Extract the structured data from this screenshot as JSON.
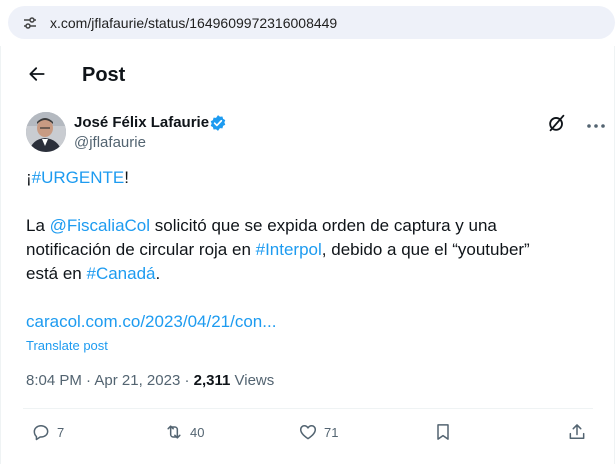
{
  "browser": {
    "url": "x.com/jflafaurie/status/1649609972316008449",
    "site_icon": "site-settings-icon"
  },
  "header": {
    "back_icon": "back-arrow-icon",
    "title": "Post"
  },
  "author": {
    "name": "José Félix Lafaurie",
    "handle": "@jflafaurie",
    "verified": true,
    "badge_color": "#1d9bf0"
  },
  "tweet": {
    "line1_prefix": "¡",
    "line1_hashtag": "#URGENTE",
    "line1_suffix": "!",
    "line2_prefix": "La ",
    "line2_mention": "@FiscaliaCol",
    "line2_suffix": " solicitó que se expida orden de captura y una",
    "line3_prefix": "notificación de circular roja en ",
    "line3_hashtag": "#Interpol",
    "line3_suffix": ", debido a que el “youtuber”",
    "line4_prefix": "está en ",
    "line4_hashtag": "#Canadá",
    "line4_suffix": "."
  },
  "link": {
    "text": "caracol.com.co/2023/04/21/con..."
  },
  "translate_label": "Translate post",
  "meta": {
    "time": "8:04 PM",
    "separator1": " · ",
    "date": "Apr 21, 2023",
    "separator2": " · ",
    "views_count": "2,311",
    "views_label": " Views"
  },
  "actions": {
    "replies": "7",
    "reposts": "40",
    "likes": "71"
  },
  "colors": {
    "accent": "#1d9bf0",
    "text": "#0f1419",
    "secondary": "#536471"
  }
}
